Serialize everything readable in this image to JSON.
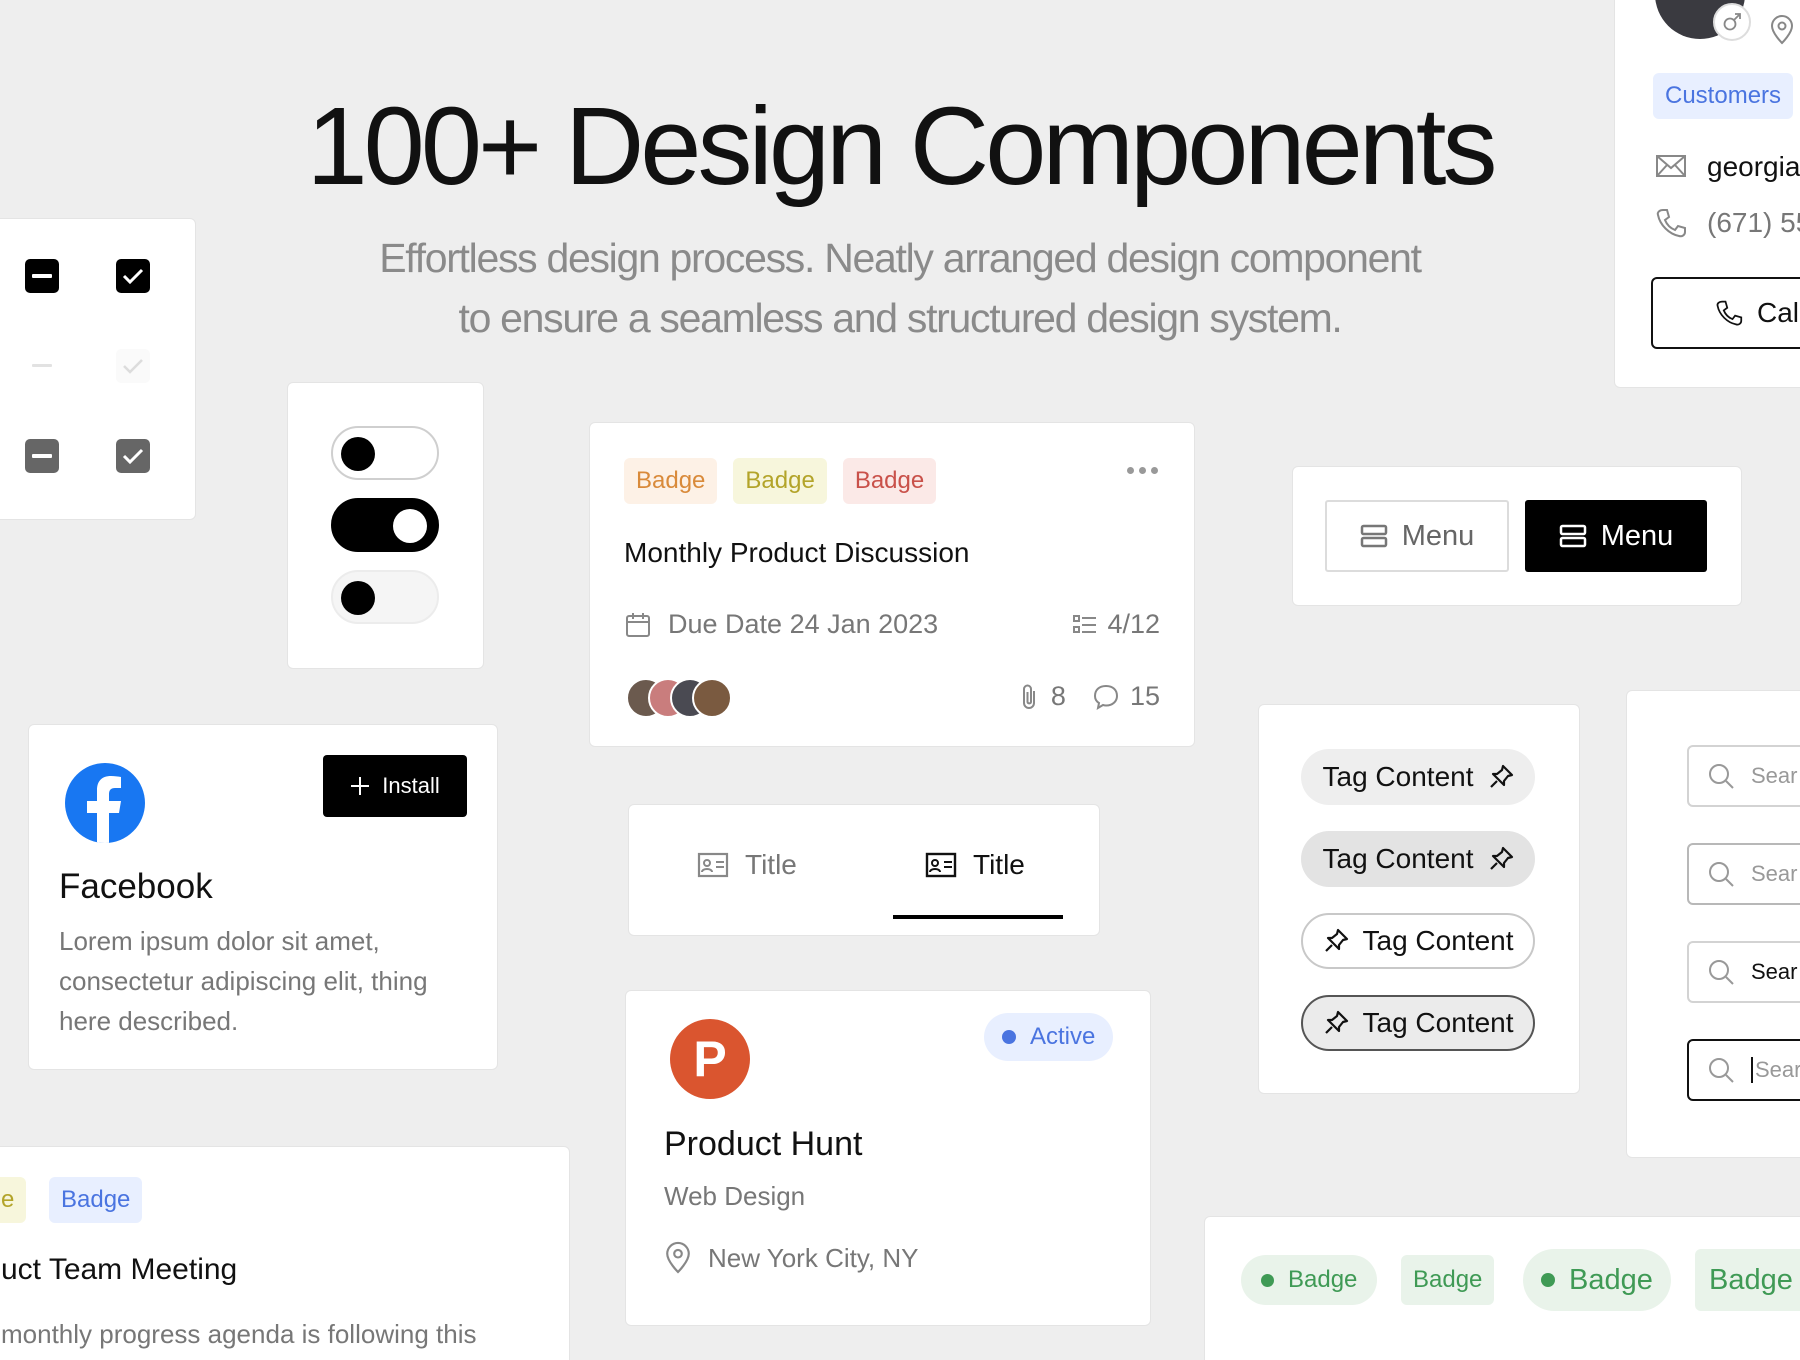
{
  "hero": {
    "title": "100+ Design Components",
    "subtitle_line1": "Effortless design process. Neatly arranged design component",
    "subtitle_line2": "to ensure a seamless and structured design system."
  },
  "colors": {
    "background": "#eeeeee",
    "badge_orange_bg": "#fdf1e6",
    "badge_orange_fg": "#d98a3a",
    "badge_yellow_bg": "#f7f6dc",
    "badge_yellow_fg": "#b3a42a",
    "badge_red_bg": "#fbe9e7",
    "badge_red_fg": "#c9514a",
    "badge_blue_bg": "#e8efff",
    "badge_blue_fg": "#4a74e0",
    "badge_green_bg": "#e9f3ea",
    "badge_green_fg": "#3f9a55",
    "producthunt": "#da552f",
    "facebook": "#1877f2"
  },
  "task_card": {
    "badges": [
      "Badge",
      "Badge",
      "Badge"
    ],
    "title": "Monthly Product Discussion",
    "due": "Due Date 24 Jan 2023",
    "progress": "4/12",
    "attachments": "8",
    "comments": "15"
  },
  "menu": {
    "light_label": "Menu",
    "dark_label": "Menu"
  },
  "facebook": {
    "install_label": "Install",
    "name": "Facebook",
    "desc_line1": "Lorem ipsum dolor sit amet,",
    "desc_line2": "consectetur adipiscing elit, thing",
    "desc_line3": "here described."
  },
  "tabs": {
    "tab1": "Title",
    "tab2": "Title"
  },
  "product": {
    "status": "Active",
    "name": "Product Hunt",
    "category": "Web Design",
    "location": "New York City, NY"
  },
  "tags": [
    "Tag Content",
    "Tag Content",
    "Tag Content",
    "Tag Content"
  ],
  "search": {
    "placeholders": [
      "Sear",
      "Sear",
      "Sear",
      "Sear"
    ]
  },
  "contact": {
    "badge": "Customers",
    "email": "georgia",
    "phone": "(671) 55",
    "call_label": "Cal"
  },
  "meeting": {
    "badge_partial": "e",
    "badge": "Badge",
    "title": "uct Team Meeting",
    "desc": "monthly progress agenda is following this"
  },
  "green_badges": [
    "Badge",
    "Badge",
    "Badge",
    "Badge"
  ]
}
